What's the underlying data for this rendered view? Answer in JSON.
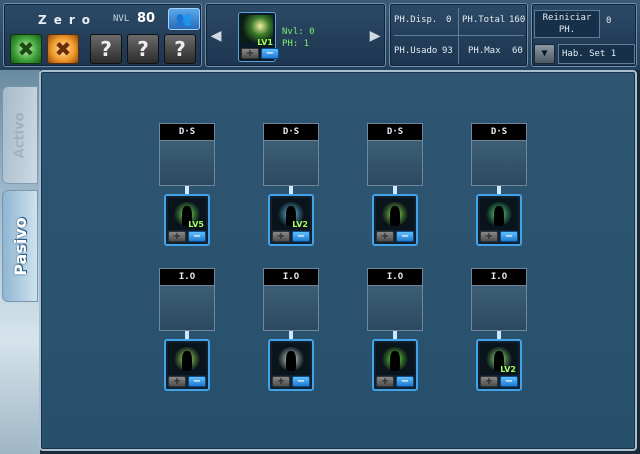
{
  "character": {
    "name": "Zero",
    "level_label": "NVL",
    "level_value": "80"
  },
  "skill_slots": [
    {
      "name": "green-cross",
      "symbol": "✖"
    },
    {
      "name": "orange-cross",
      "symbol": "✖"
    },
    {
      "name": "empty",
      "symbol": "?"
    },
    {
      "name": "empty",
      "symbol": "?"
    },
    {
      "name": "empty",
      "symbol": "?"
    }
  ],
  "current_skill": {
    "level_badge": "LV1",
    "nvl_text": "Nvl: 0",
    "ph_text": "PH: 1"
  },
  "stats": {
    "disp_label": "PH.Disp.",
    "disp_value": "0",
    "total_label": "PH.Total",
    "total_value": "160",
    "usado_label": "PH.Usado",
    "usado_value": "93",
    "max_label": "PH.Max",
    "max_value": "60"
  },
  "reset": {
    "label": "Reiniciar PH.",
    "value": "0",
    "hab_set": "Hab. Set 1"
  },
  "tabs": {
    "activo": "Activo",
    "pasivo": "Pasivo"
  },
  "row1": {
    "header": "D·S",
    "skills": [
      {
        "level": "LV5",
        "glow": "#7fff5a"
      },
      {
        "level": "LV2",
        "glow": "#6ad8ff"
      },
      {
        "level": "",
        "glow": "#9bff4a"
      },
      {
        "level": "",
        "glow": "#5aff8a"
      }
    ]
  },
  "row2": {
    "header": "I.O",
    "skills": [
      {
        "level": "",
        "glow": "#b8ff5a"
      },
      {
        "level": "",
        "glow": "#f0fff0"
      },
      {
        "level": "",
        "glow": "#7aff3a"
      },
      {
        "level": "LV2",
        "glow": "#a0ff80"
      }
    ]
  },
  "buttons": {
    "plus": "+",
    "minus": "−",
    "arrow_left": "◀",
    "arrow_right": "▶",
    "dropdown": "▼",
    "party": "👥"
  }
}
